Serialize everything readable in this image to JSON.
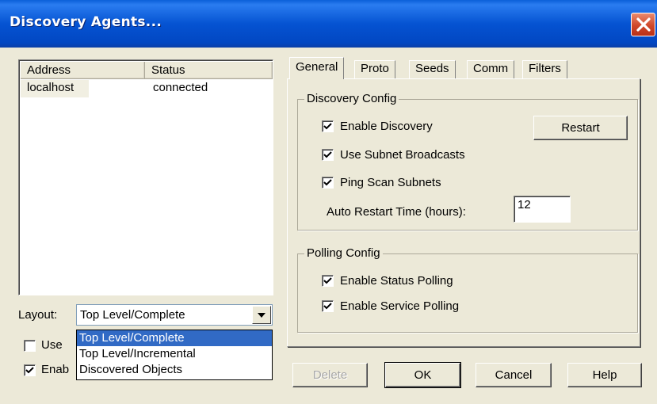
{
  "window": {
    "title": "Discovery Agents..."
  },
  "agent_list": {
    "columns": [
      "Address",
      "Status"
    ],
    "rows": [
      {
        "address": "localhost",
        "status": "connected"
      }
    ]
  },
  "layout": {
    "label": "Layout:",
    "selected": "Top Level/Complete",
    "options": [
      "Top Level/Complete",
      "Top Level/Incremental",
      "Discovered Objects"
    ]
  },
  "left_checks": [
    {
      "label": "Use",
      "checked": false
    },
    {
      "label": "Enab",
      "checked": true
    }
  ],
  "tabs": [
    {
      "label": "General",
      "active": true
    },
    {
      "label": "Proto",
      "active": false
    },
    {
      "label": "Seeds",
      "active": false
    },
    {
      "label": "Comm",
      "active": false
    },
    {
      "label": "Filters",
      "active": false
    }
  ],
  "discovery_config": {
    "title": "Discovery Config",
    "enable_discovery": {
      "label": "Enable Discovery",
      "checked": true
    },
    "use_subnet_broadcasts": {
      "label": "Use Subnet Broadcasts",
      "checked": true
    },
    "ping_scan_subnets": {
      "label": "Ping Scan Subnets",
      "checked": true
    },
    "restart_label": "Restart",
    "auto_restart_label": "Auto Restart Time (hours):",
    "auto_restart_value": "12"
  },
  "polling_config": {
    "title": "Polling Config",
    "enable_status_polling": {
      "label": "Enable Status Polling",
      "checked": true
    },
    "enable_service_polling": {
      "label": "Enable Service Polling",
      "checked": true
    }
  },
  "buttons": {
    "delete": "Delete",
    "ok": "OK",
    "cancel": "Cancel",
    "help": "Help"
  },
  "colors": {
    "title_bar": "#0553d2",
    "selection": "#316ac5",
    "dialog_bg": "#ece9d8"
  }
}
